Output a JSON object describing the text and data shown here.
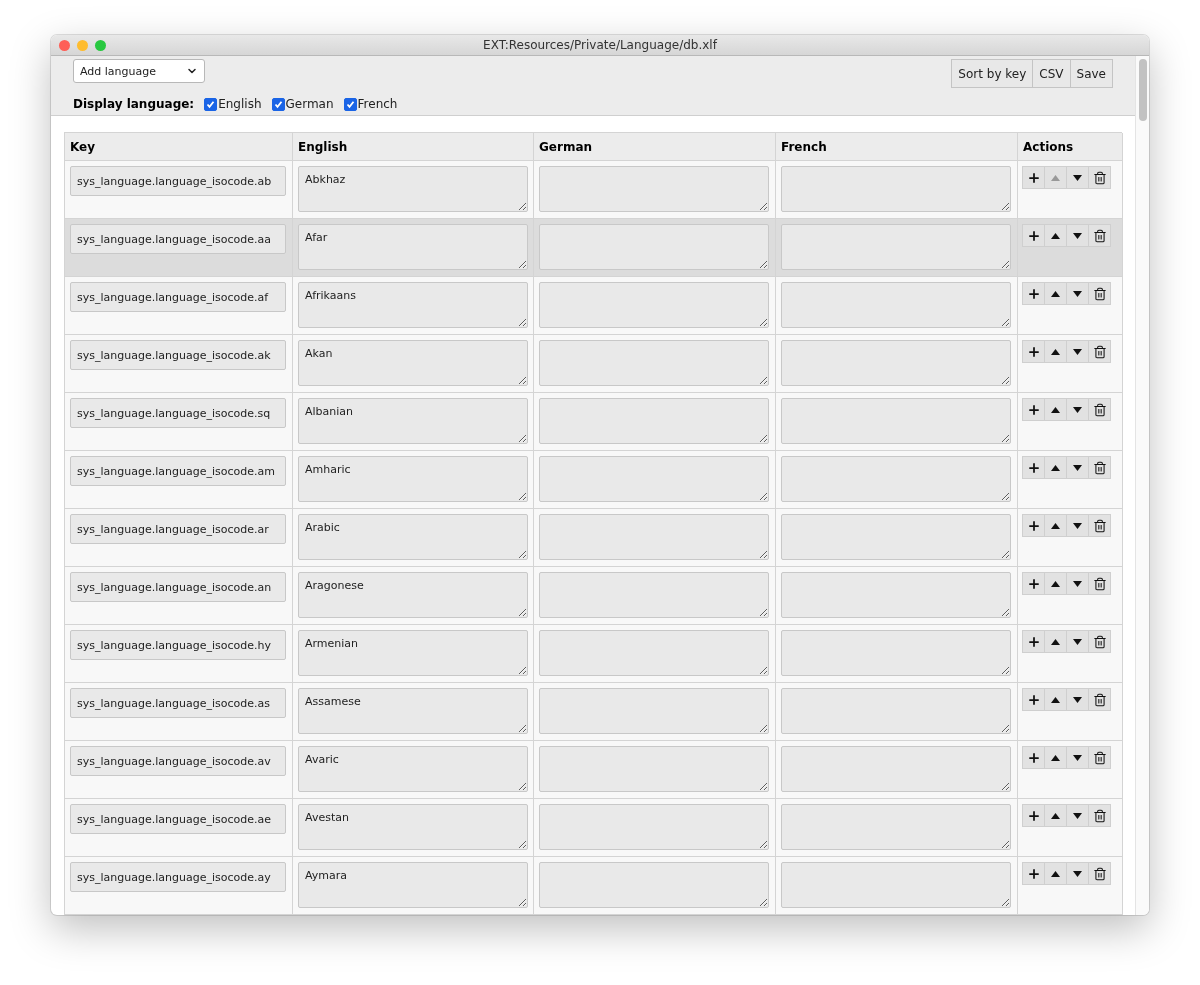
{
  "window": {
    "title": "EXT:Resources/Private/Language/db.xlf"
  },
  "toolbar": {
    "add_language": {
      "placeholder": "Add language"
    },
    "display_label": "Display language:",
    "languages": [
      {
        "label": "English",
        "checked": true
      },
      {
        "label": "German",
        "checked": true
      },
      {
        "label": "French",
        "checked": true
      }
    ],
    "buttons": [
      "Sort by key",
      "CSV",
      "Save"
    ]
  },
  "table": {
    "columns": [
      "Key",
      "English",
      "German",
      "French",
      "Actions"
    ],
    "rows": [
      {
        "key": "sys_language.language_isocode.ab",
        "values": [
          "Abkhaz"
        ],
        "highlighted": false,
        "up_disabled": true
      },
      {
        "key": "sys_language.language_isocode.aa",
        "values": [
          "Afar"
        ],
        "highlighted": true,
        "up_disabled": false
      },
      {
        "key": "sys_language.language_isocode.af",
        "values": [
          "Afrikaans"
        ],
        "highlighted": false,
        "up_disabled": false
      },
      {
        "key": "sys_language.language_isocode.ak",
        "values": [
          "Akan"
        ],
        "highlighted": false,
        "up_disabled": false
      },
      {
        "key": "sys_language.language_isocode.sq",
        "values": [
          "Albanian"
        ],
        "highlighted": false,
        "up_disabled": false
      },
      {
        "key": "sys_language.language_isocode.am",
        "values": [
          "Amharic"
        ],
        "highlighted": false,
        "up_disabled": false
      },
      {
        "key": "sys_language.language_isocode.ar",
        "values": [
          "Arabic"
        ],
        "highlighted": false,
        "up_disabled": false
      },
      {
        "key": "sys_language.language_isocode.an",
        "values": [
          "Aragonese"
        ],
        "highlighted": false,
        "up_disabled": false
      },
      {
        "key": "sys_language.language_isocode.hy",
        "values": [
          "Armenian"
        ],
        "highlighted": false,
        "up_disabled": false
      },
      {
        "key": "sys_language.language_isocode.as",
        "values": [
          "Assamese"
        ],
        "highlighted": false,
        "up_disabled": false
      },
      {
        "key": "sys_language.language_isocode.av",
        "values": [
          "Avaric"
        ],
        "highlighted": false,
        "up_disabled": false
      },
      {
        "key": "sys_language.language_isocode.ae",
        "values": [
          "Avestan"
        ],
        "highlighted": false,
        "up_disabled": false
      },
      {
        "key": "sys_language.language_isocode.ay",
        "values": [
          "Aymara"
        ],
        "highlighted": false,
        "up_disabled": false
      }
    ]
  }
}
